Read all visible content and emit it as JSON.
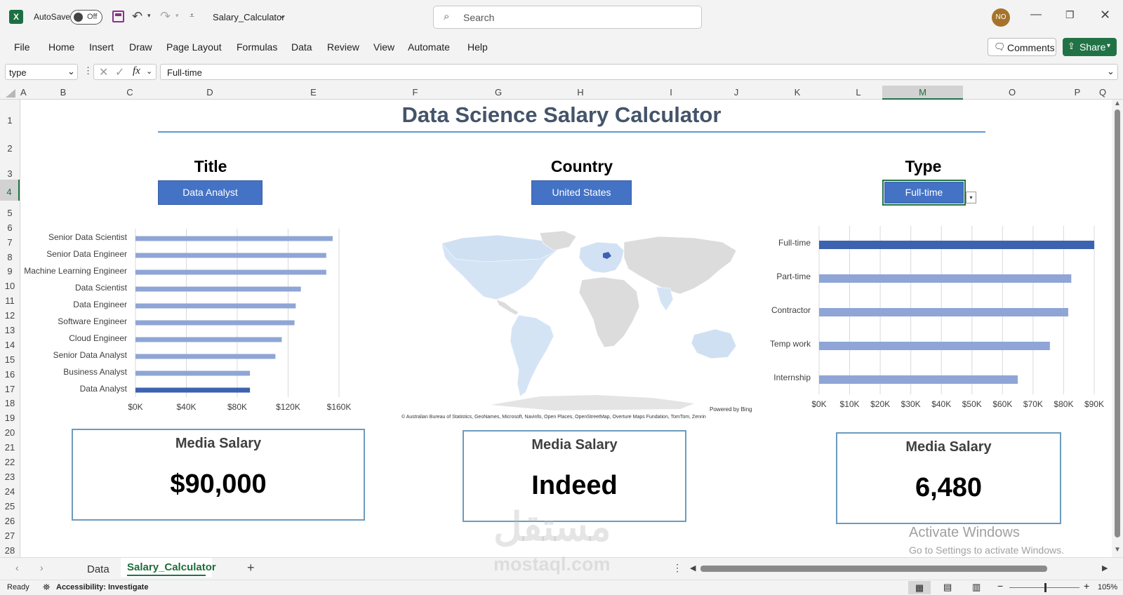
{
  "app": {
    "autosave_label": "AutoSave",
    "autosave_state": "Off",
    "filename": "Salary_Calculator",
    "search_placeholder": "Search",
    "avatar_initials": "NO"
  },
  "menu": [
    "File",
    "Home",
    "Insert",
    "Draw",
    "Page Layout",
    "Formulas",
    "Data",
    "Review",
    "View",
    "Automate",
    "Help"
  ],
  "comments_label": "Comments",
  "share_label": "Share",
  "namebox": "type",
  "formula_value": "Full-time",
  "columns": [
    "A",
    "B",
    "C",
    "D",
    "E",
    "F",
    "G",
    "H",
    "I",
    "J",
    "K",
    "L",
    "M",
    "O",
    "P",
    "Q"
  ],
  "rows": [
    "1",
    "2",
    "3",
    "4",
    "5",
    "6",
    "7",
    "8",
    "9",
    "10",
    "11",
    "12",
    "13",
    "14",
    "15",
    "16",
    "17",
    "18",
    "19",
    "20",
    "21",
    "22",
    "23",
    "24",
    "25",
    "26",
    "27",
    "28"
  ],
  "sheet": {
    "main_title": "Data Science Salary Calculator",
    "title_label": "Title",
    "title_value": "Data Analyst",
    "country_label": "Country",
    "country_value": "United States",
    "type_label": "Type",
    "type_value": "Full-time",
    "map_powered": "Powered by Bing",
    "map_credit": "© Australian Bureau of Statistics, GeoNames, Microsoft, Navinfo, Open Places, OpenStreetMap, Overture Maps Fundation, TomTom, Zenrin",
    "cards": [
      {
        "title": "Media Salary",
        "value": "$90,000"
      },
      {
        "title": "Media Salary",
        "value": "Indeed"
      },
      {
        "title": "Media Salary",
        "value": "6,480"
      }
    ],
    "watermark_text": "مستقل",
    "watermark_url": "mostaql.com",
    "activate_title": "Activate Windows",
    "activate_sub": "Go to Settings to activate Windows."
  },
  "tabs": [
    {
      "label": "Data",
      "active": false
    },
    {
      "label": "Salary_Calculator",
      "active": true
    }
  ],
  "status": {
    "ready": "Ready",
    "accessibility": "Accessibility: Investigate",
    "zoom": "105%"
  },
  "colors": {
    "bar_light": "#8ea5d6",
    "bar_dark": "#3d62b0",
    "pill": "#4472c4",
    "excel_green": "#217346"
  },
  "chart_data": [
    {
      "type": "bar",
      "orientation": "horizontal",
      "categories": [
        "Senior Data Scientist",
        "Senior Data Engineer",
        "Machine Learning Engineer",
        "Data Scientist",
        "Data Engineer",
        "Software Engineer",
        "Cloud Engineer",
        "Senior Data Analyst",
        "Business Analyst",
        "Data Analyst"
      ],
      "values": [
        155000,
        150000,
        150000,
        130000,
        126000,
        125000,
        115000,
        110000,
        90000,
        90000
      ],
      "highlight": "Data Analyst",
      "xticks": [
        "$0K",
        "$40K",
        "$80K",
        "$120K",
        "$160K"
      ],
      "xlim": [
        0,
        160000
      ],
      "grid": true
    },
    {
      "type": "bar",
      "orientation": "horizontal",
      "categories": [
        "Full-time",
        "Part-time",
        "Contractor",
        "Temp work",
        "Internship"
      ],
      "values": [
        90000,
        82500,
        81500,
        75500,
        65000
      ],
      "highlight": "Full-time",
      "xticks": [
        "$0K",
        "$10K",
        "$20K",
        "$30K",
        "$40K",
        "$50K",
        "$60K",
        "$70K",
        "$80K",
        "$90K"
      ],
      "xlim": [
        0,
        90000
      ],
      "grid": true
    }
  ]
}
